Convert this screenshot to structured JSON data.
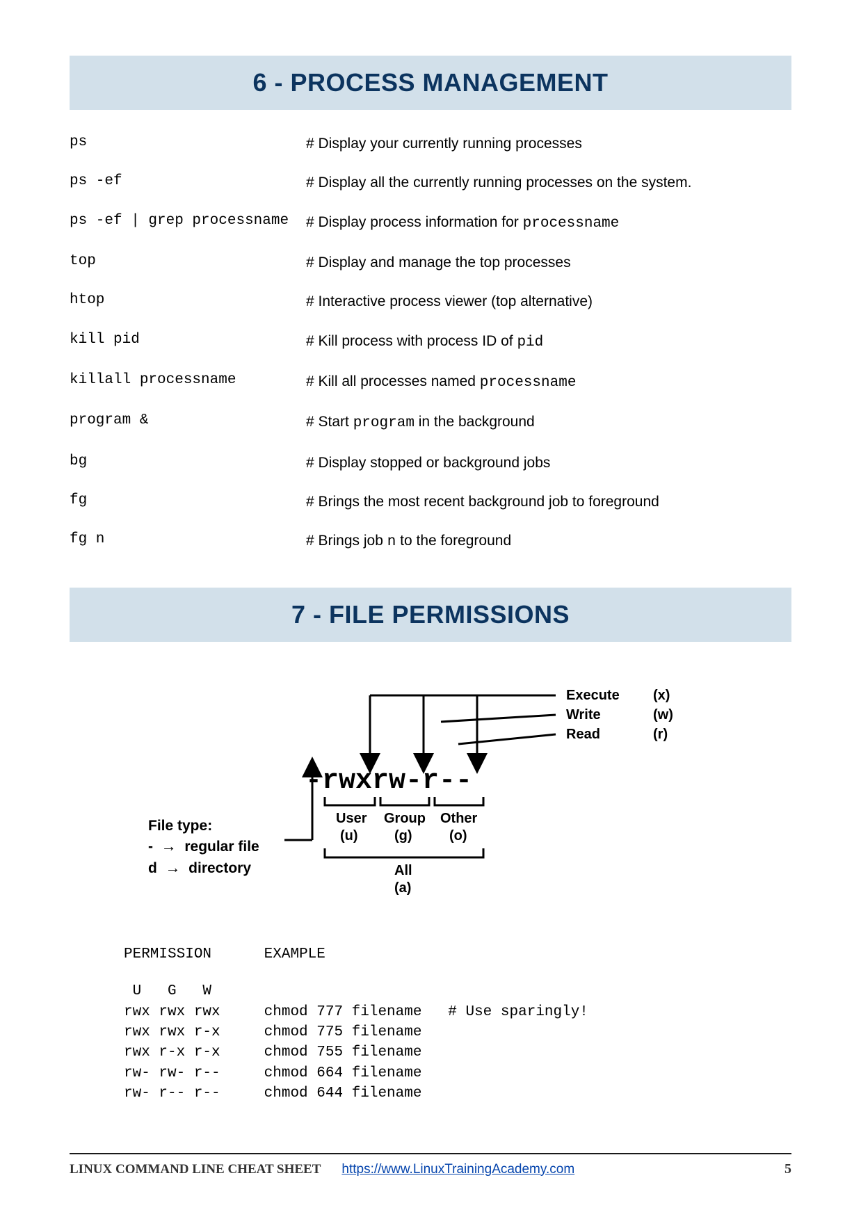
{
  "sections": {
    "process": {
      "title": "6 - PROCESS MANAGEMENT",
      "rows": [
        {
          "cmd": "ps",
          "desc_pre": "# Display your currently running processes",
          "mono": "",
          "desc_post": ""
        },
        {
          "cmd": "ps -ef",
          "desc_pre": "# Display all the currently running processes on the system.",
          "mono": "",
          "desc_post": ""
        },
        {
          "cmd": "ps -ef | grep processname",
          "desc_pre": "# Display process information for ",
          "mono": "processname",
          "desc_post": ""
        },
        {
          "cmd": "top",
          "desc_pre": "# Display and manage the top processes",
          "mono": "",
          "desc_post": ""
        },
        {
          "cmd": "htop",
          "desc_pre": "# Interactive process viewer (top alternative)",
          "mono": "",
          "desc_post": ""
        },
        {
          "cmd": "kill pid",
          "desc_pre": "# Kill process with process ID of ",
          "mono": "pid",
          "desc_post": ""
        },
        {
          "cmd": "killall processname",
          "desc_pre": "# Kill all processes named ",
          "mono": "processname",
          "desc_post": ""
        },
        {
          "cmd": "program &",
          "desc_pre": "# Start ",
          "mono": "program",
          "desc_post": " in the background"
        },
        {
          "cmd": "bg",
          "desc_pre": "# Display stopped or background jobs",
          "mono": "",
          "desc_post": ""
        },
        {
          "cmd": "fg",
          "desc_pre": "# Brings the most recent background job to foreground",
          "mono": "",
          "desc_post": ""
        },
        {
          "cmd": "fg n",
          "desc_pre": "# Brings job ",
          "mono": "n",
          "desc_post": " to the foreground"
        }
      ]
    },
    "permissions": {
      "title": "7 - FILE PERMISSIONS"
    }
  },
  "diagram": {
    "perm_string": "-rwxrw-r--",
    "legend": {
      "execute": "Execute",
      "execute_sym": "(x)",
      "write": "Write",
      "write_sym": "(w)",
      "read": "Read",
      "read_sym": "(r)"
    },
    "groups": {
      "user": "User",
      "user_sym": "(u)",
      "group": "Group",
      "group_sym": "(g)",
      "other": "Other",
      "other_sym": "(o)",
      "all": "All",
      "all_sym": "(a)"
    },
    "file_type": {
      "title": "File type:",
      "regular_sym": "-",
      "regular": "regular file",
      "dir_sym": "d",
      "dir": "directory"
    }
  },
  "perm_table": {
    "header_perm": "PERMISSION",
    "header_ex": "EXAMPLE",
    "ugw": " U   G   W",
    "rows": [
      "rwx rwx rwx     chmod 777 filename   # Use sparingly!",
      "rwx rwx r-x     chmod 775 filename",
      "rwx r-x r-x     chmod 755 filename",
      "rw- rw- r--     chmod 664 filename",
      "rw- r-- r--     chmod 644 filename"
    ]
  },
  "footer": {
    "title": "LINUX COMMAND LINE CHEAT SHEET",
    "link": "https://www.LinuxTrainingAcademy.com",
    "page": "5"
  }
}
